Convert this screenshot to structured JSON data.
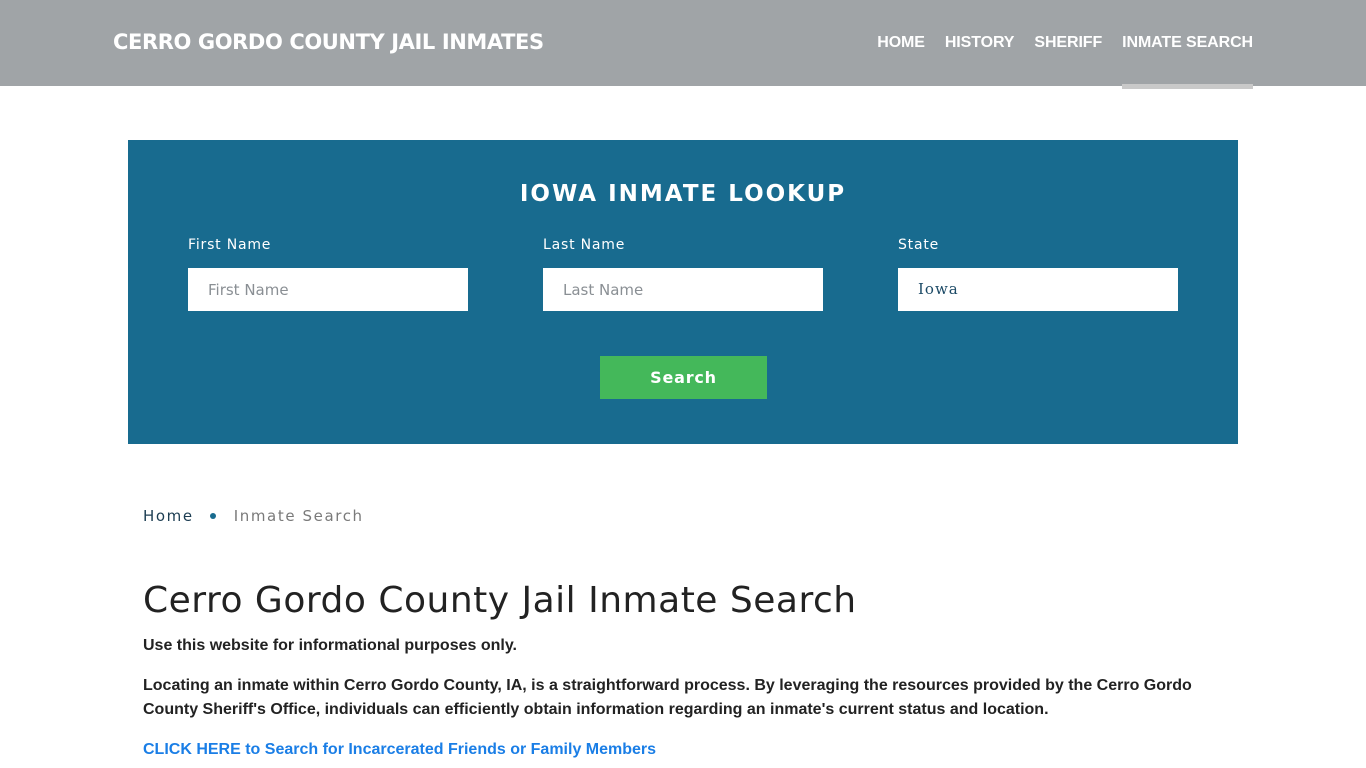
{
  "header": {
    "brand": "CERRO GORDO COUNTY JAIL INMATES",
    "nav": [
      {
        "label": "HOME",
        "active": false
      },
      {
        "label": "HISTORY",
        "active": false
      },
      {
        "label": "SHERIFF",
        "active": false
      },
      {
        "label": "INMATE SEARCH",
        "active": true
      }
    ]
  },
  "lookup": {
    "title": "IOWA INMATE LOOKUP",
    "first_name": {
      "label": "First Name",
      "placeholder": "First Name",
      "value": ""
    },
    "last_name": {
      "label": "Last Name",
      "placeholder": "Last Name",
      "value": ""
    },
    "state": {
      "label": "State",
      "value": "Iowa"
    },
    "search_label": "Search"
  },
  "breadcrumb": {
    "home": "Home",
    "current": "Inmate Search"
  },
  "main": {
    "title": "Cerro Gordo County Jail Inmate Search",
    "disclaimer": "Use this website for informational purposes only.",
    "intro": "Locating an inmate within Cerro Gordo County, IA, is a straightforward process. By leveraging the resources provided by the Cerro Gordo County Sheriff's Office, individuals can efficiently obtain information regarding an inmate's current status and location.",
    "cta": "CLICK HERE to Search for Incarcerated Friends or Family Members"
  },
  "colors": {
    "header_bg": "#a0a4a7",
    "lookup_bg": "#186b8f",
    "button_green": "#44b85a",
    "link_blue": "#1a7ee6"
  }
}
